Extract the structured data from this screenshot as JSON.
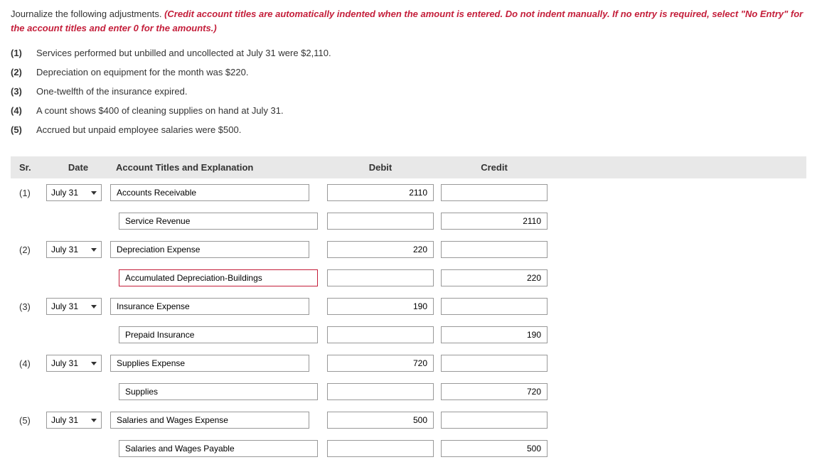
{
  "instruction": {
    "prefix": "Journalize the following adjustments. ",
    "emphasis": "(Credit account titles are automatically indented when the amount is entered. Do not indent manually. If no entry is required, select \"No Entry\" for the account titles and enter 0 for the amounts.)"
  },
  "problems": [
    {
      "num": "(1)",
      "text": "Services performed but unbilled and uncollected at July 31 were $2,110."
    },
    {
      "num": "(2)",
      "text": "Depreciation on equipment for the month was $220."
    },
    {
      "num": "(3)",
      "text": "One-twelfth of the insurance expired."
    },
    {
      "num": "(4)",
      "text": "A count shows $400 of cleaning supplies on hand at July 31."
    },
    {
      "num": "(5)",
      "text": "Accrued but unpaid employee salaries were $500."
    }
  ],
  "headers": {
    "sr": "Sr.",
    "date": "Date",
    "account": "Account Titles and Explanation",
    "debit": "Debit",
    "credit": "Credit"
  },
  "entries": [
    {
      "sr": "(1)",
      "date": "July 31",
      "rows": [
        {
          "account": "Accounts Receivable",
          "debit": "2110",
          "credit": "",
          "indent": false,
          "error": false
        },
        {
          "account": "Service Revenue",
          "debit": "",
          "credit": "2110",
          "indent": true,
          "error": false
        }
      ]
    },
    {
      "sr": "(2)",
      "date": "July 31",
      "rows": [
        {
          "account": "Depreciation Expense",
          "debit": "220",
          "credit": "",
          "indent": false,
          "error": false
        },
        {
          "account": "Accumulated Depreciation-Buildings",
          "debit": "",
          "credit": "220",
          "indent": true,
          "error": true
        }
      ]
    },
    {
      "sr": "(3)",
      "date": "July 31",
      "rows": [
        {
          "account": "Insurance Expense",
          "debit": "190",
          "credit": "",
          "indent": false,
          "error": false
        },
        {
          "account": "Prepaid Insurance",
          "debit": "",
          "credit": "190",
          "indent": true,
          "error": false
        }
      ]
    },
    {
      "sr": "(4)",
      "date": "July 31",
      "rows": [
        {
          "account": "Supplies Expense",
          "debit": "720",
          "credit": "",
          "indent": false,
          "error": false
        },
        {
          "account": "Supplies",
          "debit": "",
          "credit": "720",
          "indent": true,
          "error": false
        }
      ]
    },
    {
      "sr": "(5)",
      "date": "July 31",
      "rows": [
        {
          "account": "Salaries and Wages Expense",
          "debit": "500",
          "credit": "",
          "indent": false,
          "error": false
        },
        {
          "account": "Salaries and Wages Payable",
          "debit": "",
          "credit": "500",
          "indent": true,
          "error": false
        }
      ]
    }
  ]
}
